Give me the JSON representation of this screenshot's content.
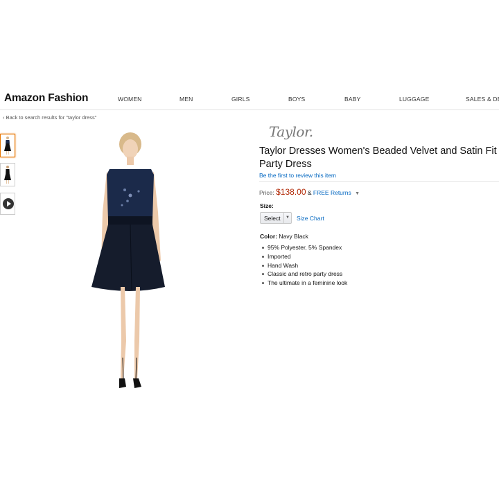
{
  "header": {
    "brand": "Amazon Fashion",
    "nav": [
      "WOMEN",
      "MEN",
      "GIRLS",
      "BOYS",
      "BABY",
      "LUGGAGE",
      "SALES & DEA"
    ]
  },
  "breadcrumb": {
    "back_text": "‹ Back to search results for \"taylor dress\""
  },
  "thumbnails": [
    {
      "label": "front view",
      "selected": true
    },
    {
      "label": "back view",
      "selected": false
    },
    {
      "label": "video",
      "selected": false
    }
  ],
  "product": {
    "brand_logo": "Taylor.",
    "title_line1": "Taylor Dresses Women's Beaded Velvet and Satin Fit an",
    "title_line2": "Party Dress",
    "review_link": "Be the first to review this item",
    "price_label": "Price:",
    "price": "$138.00",
    "amp": "&",
    "free_returns": "FREE Returns",
    "size_label": "Size:",
    "size_select": "Select",
    "size_chart": "Size Chart",
    "color_label": "Color:",
    "color_value": "Navy Black",
    "features": [
      "95% Polyester, 5% Spandex",
      "Imported",
      "Hand Wash",
      "Classic and retro party dress",
      "The ultimate in a feminine look"
    ]
  },
  "colors": {
    "link": "#0066c0",
    "price": "#b12704",
    "thumb_selected": "#e77600",
    "dress_navy": "#1b2a4a",
    "dress_black": "#111111"
  }
}
